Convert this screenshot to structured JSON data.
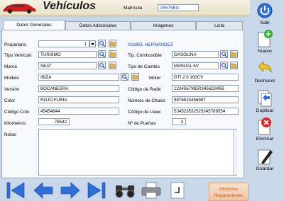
{
  "header": {
    "title": "Vehículos",
    "matricula_label": "Matrícula",
    "matricula_value": "V5675ES"
  },
  "tabs": [
    {
      "label": "Datos Generales",
      "active": true
    },
    {
      "label": "Datos Adicionales"
    },
    {
      "label": "Imagenes"
    },
    {
      "label": "Lista"
    }
  ],
  "form": {
    "propietario_label": "Propietario",
    "propietario_value": "1",
    "propietario_name": "ISABEL HERNANDEZ",
    "tipo_vehiculo_label": "Tipo.Vehículo",
    "tipo_vehiculo_value": "TURISMO",
    "tipo_combustible_label": "Tip. Combustible",
    "tipo_combustible_value": "GASOLINA",
    "marca_label": "Marca",
    "marca_value": "SEAT",
    "tipo_cambio_label": "Tipo de Cambio",
    "tipo_cambio_value": "MANUAL 6V",
    "modelo_label": "Modelo",
    "modelo_value": "IBIZA",
    "motor_label": "Motor",
    "motor_value": "GTI 2.0 160CV",
    "version_label": "Versión",
    "version_value": "BOCANEGRA",
    "codigo_radio_label": "Código de Radic",
    "codigo_radio_value": "1234567WER3456D3456",
    "color_label": "Color",
    "color_value": "ROJO FURIA",
    "num_chasis_label": "Número de Chasis",
    "num_chasis_value": "9876523456987",
    "codigo_color_label": "Código Colo",
    "codigo_color_value": "45454844",
    "codigo_llave_label": "Código de Llave",
    "codigo_llave_value": "534523532525345789554",
    "kilometros_label": "Kilometros",
    "kilometros_value": "78542",
    "num_puertas_label": "Nº de Puertas",
    "num_puertas_value": "3",
    "notas_label": "Notas",
    "notas_value": ""
  },
  "sidebar": {
    "salir": "Salir",
    "nuevo": "Nuevo",
    "deshacer": "Deshacer",
    "duplicar": "Duplicar",
    "eliminar": "Eliminar",
    "guardar": "Guardar"
  },
  "bottom": {
    "historico_line1": "Histórico",
    "historico_line2": "Reparaciones"
  },
  "colors": {
    "nav_blue": "#2f6fd6",
    "accent_blue": "#1a3f9a",
    "historico_text": "#d04f1c"
  }
}
